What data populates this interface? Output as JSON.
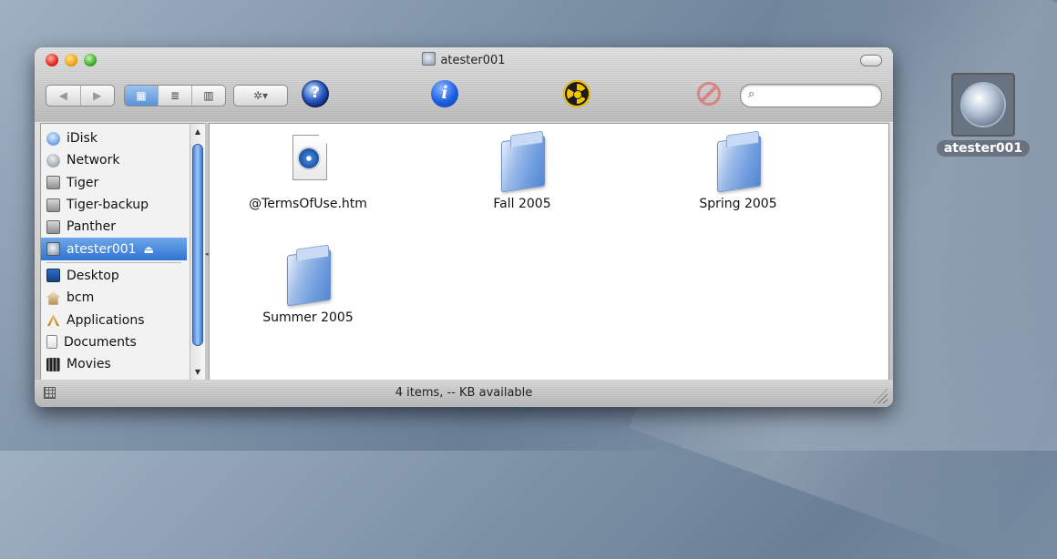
{
  "window": {
    "title": "atester001"
  },
  "toolbar": {
    "back_glyph": "◀",
    "forward_glyph": "▶",
    "view_icon": "▦",
    "view_list": "≣",
    "view_columns": "▥",
    "action_label": "✲▾",
    "info_label": "i",
    "search": {
      "value": "",
      "placeholder": "",
      "icon": "⌕"
    }
  },
  "sidebar": {
    "devices": [
      {
        "label": "iDisk",
        "icon": "idisk-icon"
      },
      {
        "label": "Network",
        "icon": "network-icon"
      },
      {
        "label": "Tiger",
        "icon": "hard-drive-icon"
      },
      {
        "label": "Tiger-backup",
        "icon": "hard-drive-icon"
      },
      {
        "label": "Panther",
        "icon": "hard-drive-icon"
      },
      {
        "label": "atester001",
        "icon": "network-volume-icon",
        "selected": true,
        "eject": "⏏"
      }
    ],
    "places": [
      {
        "label": "Desktop",
        "icon": "desktop-icon"
      },
      {
        "label": "bcm",
        "icon": "home-icon"
      },
      {
        "label": "Applications",
        "icon": "applications-icon"
      },
      {
        "label": "Documents",
        "icon": "documents-icon"
      },
      {
        "label": "Movies",
        "icon": "movies-icon"
      }
    ]
  },
  "files": [
    {
      "name": "@TermsOfUse.htm",
      "icon": "html-document-icon"
    },
    {
      "name": "Fall 2005",
      "icon": "folder-icon"
    },
    {
      "name": "Spring 2005",
      "icon": "folder-icon"
    },
    {
      "name": "Summer 2005",
      "icon": "folder-icon"
    }
  ],
  "status": {
    "text": "4 items, -- KB available"
  },
  "desktop": {
    "volume_label": "atester001"
  },
  "colors": {
    "selection": "#3a7bd5",
    "window_bg": "#c8c8c8"
  }
}
